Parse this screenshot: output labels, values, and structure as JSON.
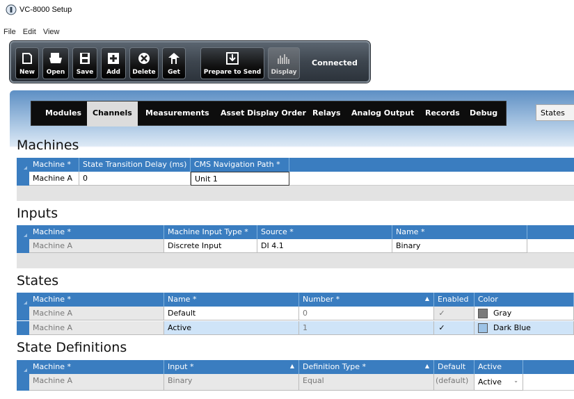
{
  "window": {
    "title": "VC-8000 Setup"
  },
  "menu": [
    "File",
    "Edit",
    "View"
  ],
  "toolbar": {
    "buttons": [
      "New",
      "Open",
      "Save",
      "Add",
      "Delete",
      "Get",
      "Prepare to Send",
      "Display"
    ],
    "status": "Connected"
  },
  "tabs": [
    "Modules",
    "Channels",
    "Measurements",
    "Asset Display Order",
    "Relays",
    "Analog Output",
    "Records",
    "Debug"
  ],
  "active_tab": "Channels",
  "states_dropdown": "States",
  "machines": {
    "title": "Machines",
    "headers": [
      "Machine *",
      "State Transition Delay (ms)",
      "CMS Navigation Path *"
    ],
    "rows": [
      [
        "Machine A",
        "0",
        "Unit 1"
      ]
    ]
  },
  "inputs": {
    "title": "Inputs",
    "headers": [
      "Machine *",
      "Machine Input Type *",
      "Source *",
      "Name *"
    ],
    "rows": [
      [
        "Machine A",
        "Discrete Input",
        "DI 4.1",
        "Binary"
      ]
    ]
  },
  "states": {
    "title": "States",
    "headers": [
      "Machine *",
      "Name *",
      "Number *",
      "Enabled",
      "Color"
    ],
    "rows": [
      [
        "Machine A",
        "Default",
        "0",
        "✓",
        "Gray"
      ],
      [
        "Machine A",
        "Active",
        "1",
        "✓",
        "Dark Blue"
      ]
    ],
    "colors": [
      "#7a7a7a",
      "#9dc3e6"
    ]
  },
  "state_definitions": {
    "title": "State Definitions",
    "headers": [
      "Machine *",
      "Input *",
      "Definition Type *",
      "Default",
      "Active"
    ],
    "rows": [
      [
        "Machine A",
        "Binary",
        "Equal",
        "(default)",
        "Active"
      ]
    ]
  }
}
